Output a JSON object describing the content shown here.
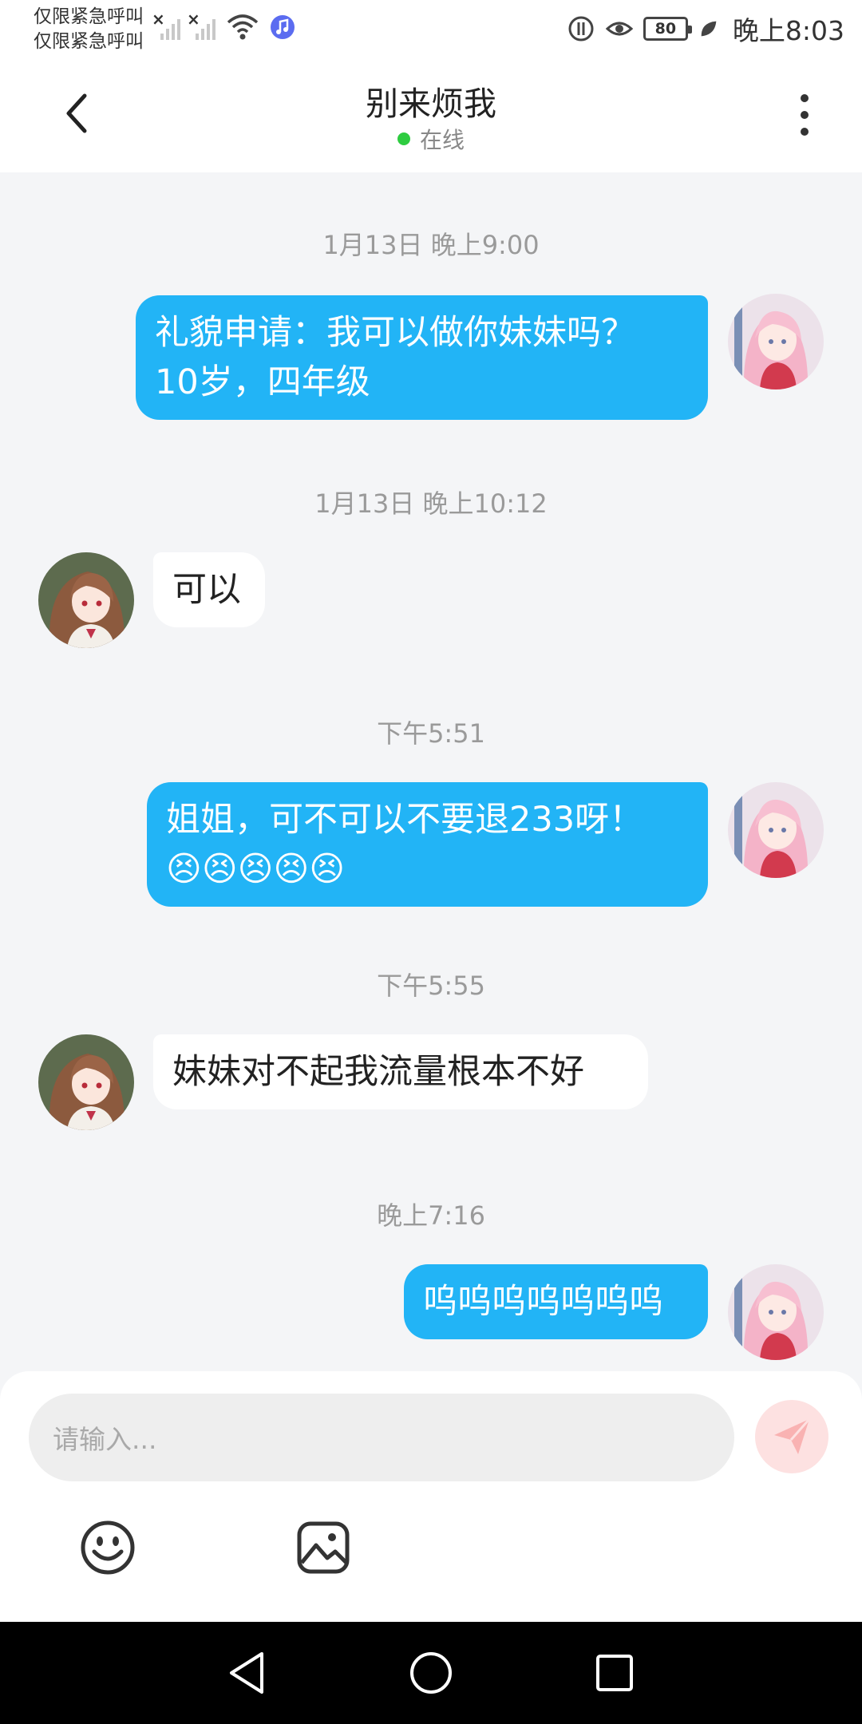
{
  "status_bar": {
    "carrier_line1": "仅限紧急呼叫",
    "carrier_line2": "仅限紧急呼叫",
    "battery": "80",
    "time": "晚上8:03"
  },
  "header": {
    "title": "别来烦我",
    "status": "在线",
    "online_color": "#2ecc40"
  },
  "messages": [
    {
      "timestamp": "1月13日 晚上9:00",
      "direction": "out",
      "text_line1": "礼貌申请：我可以做你妹妹吗？",
      "text_line2": "10岁，四年级"
    },
    {
      "timestamp": "1月13日 晚上10:12",
      "direction": "in",
      "text": "可以"
    },
    {
      "timestamp": "下午5:51",
      "direction": "out",
      "text_line1": "姐姐，可不可以不要退233呀！",
      "emoji": "😣😣😣😣😣"
    },
    {
      "timestamp": "下午5:55",
      "direction": "in",
      "text": "妹妹对不起我流量根本不好"
    },
    {
      "timestamp": "晚上7:16",
      "direction": "out",
      "text": "呜呜呜呜呜呜呜"
    }
  ],
  "composer": {
    "placeholder": "请输入..."
  },
  "colors": {
    "outgoing_bubble": "#22b4f6",
    "incoming_bubble": "#ffffff",
    "background": "#f4f5f7",
    "send_button": "#fde1e1"
  },
  "icons": [
    "back-arrow-icon",
    "more-vertical-icon",
    "send-icon",
    "emoji-icon",
    "image-icon",
    "nav-back-icon",
    "nav-home-icon",
    "nav-recents-icon"
  ]
}
